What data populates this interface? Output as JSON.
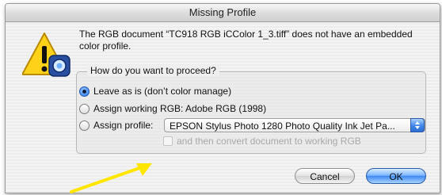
{
  "dialog": {
    "title": "Missing Profile",
    "message": "The RGB document “TC918 RGB iCColor 1_3.tiff” does not have an embedded color profile.",
    "icon": "warning-triangle-photoshop-icon"
  },
  "options": {
    "legend": "How do you want to proceed?",
    "leave_as_is": "Leave as is (don’t color manage)",
    "assign_working": "Assign working RGB:  Adobe RGB (1998)",
    "assign_profile": "Assign profile:",
    "selected": "leave_as_is",
    "profile_value": "EPSON Stylus Photo 1280 Photo Quality Ink Jet Pa...",
    "convert_label": "and then convert document to working RGB",
    "convert_checked": false,
    "convert_enabled": false
  },
  "buttons": {
    "cancel": "Cancel",
    "ok": "OK"
  },
  "colors": {
    "accent_blue": "#3f89f0",
    "annotation_arrow": "#ffe600"
  }
}
